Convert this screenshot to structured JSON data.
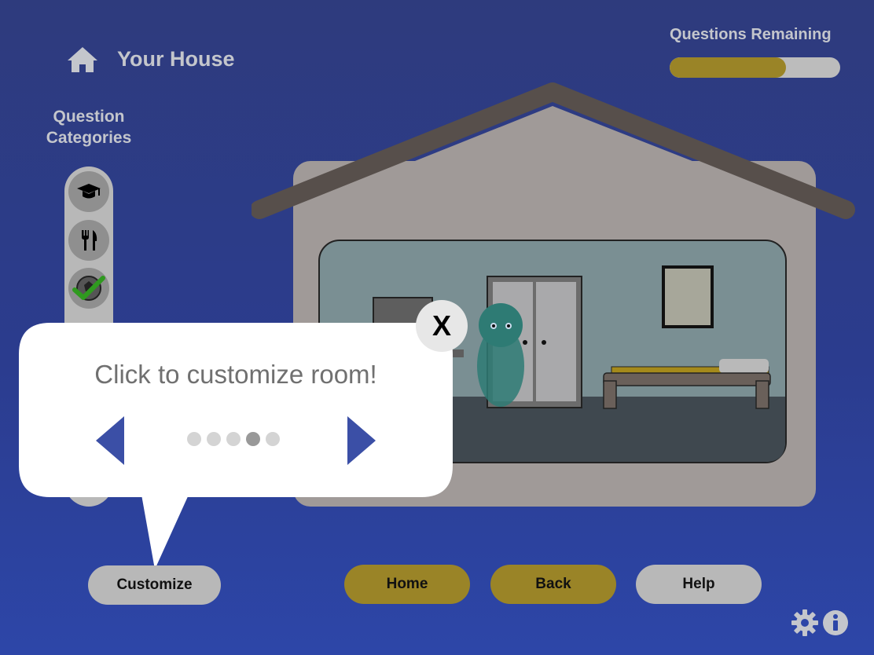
{
  "header": {
    "title": "Your House",
    "questions_remaining_label": "Questions Remaining",
    "progress_fraction": 0.68
  },
  "sidebar": {
    "label_line1": "Question",
    "label_line2": "Categories",
    "categories": [
      {
        "icon": "graduation-cap-icon",
        "state": "default"
      },
      {
        "icon": "fork-knife-icon",
        "state": "default"
      },
      {
        "icon": "soccer-ball-icon",
        "state": "completed"
      }
    ]
  },
  "tooltip": {
    "text": "Click to customize room!",
    "close_label": "X",
    "page_count": 5,
    "active_page": 3
  },
  "buttons": {
    "customize": "Customize",
    "home": "Home",
    "back": "Back",
    "help": "Help"
  },
  "colors": {
    "gold": "#9a8427",
    "grey_button": "#b8b8b8",
    "arrow_blue": "#3b4fa6"
  }
}
